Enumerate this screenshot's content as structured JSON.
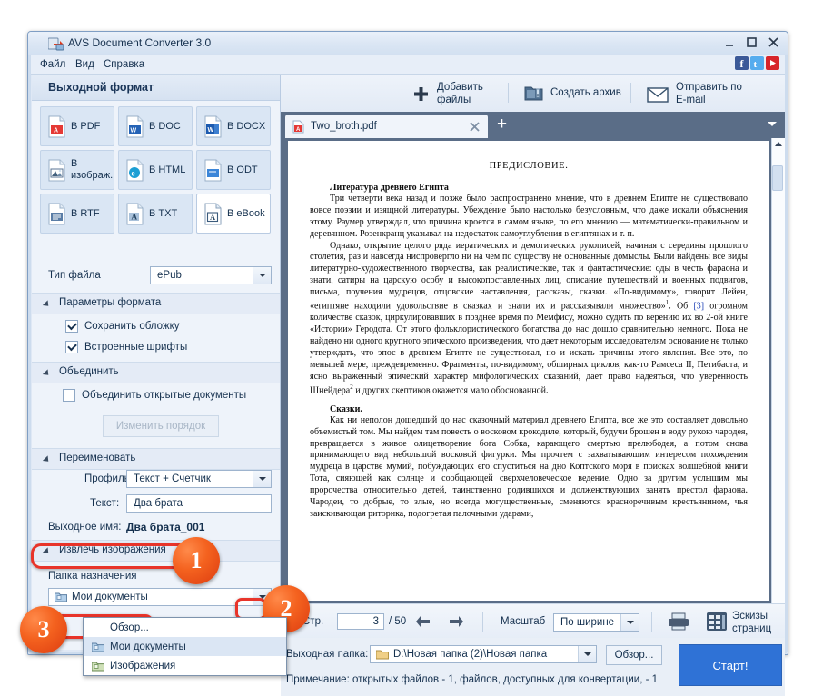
{
  "window": {
    "title": "AVS Document Converter 3.0",
    "icon": "avs-app-icon",
    "controls": {
      "minimize": "minimize-icon",
      "maximize": "maximize-icon",
      "close": "close-icon"
    }
  },
  "menu": {
    "items": [
      "Файл",
      "Вид",
      "Справка"
    ]
  },
  "social": [
    {
      "name": "facebook-icon",
      "glyph": "f",
      "color": "#3b5998"
    },
    {
      "name": "twitter-icon",
      "glyph": "t",
      "color": "#55acee"
    },
    {
      "name": "youtube-icon",
      "glyph": "▶",
      "color": "#d7242a"
    }
  ],
  "left_panel": {
    "header": "Выходной формат",
    "formats": [
      {
        "label": "В PDF",
        "icon": "pdf-file-icon",
        "selected": false
      },
      {
        "label": "В DOC",
        "icon": "doc-file-icon",
        "selected": false
      },
      {
        "label": "В DOCX",
        "icon": "docx-file-icon",
        "selected": false
      },
      {
        "label": "В изображ.",
        "icon": "image-file-icon",
        "selected": false
      },
      {
        "label": "В HTML",
        "icon": "html-file-icon",
        "selected": false
      },
      {
        "label": "В ODT",
        "icon": "odt-file-icon",
        "selected": false
      },
      {
        "label": "В RTF",
        "icon": "rtf-file-icon",
        "selected": false
      },
      {
        "label": "В TXT",
        "icon": "txt-file-icon",
        "selected": false
      },
      {
        "label": "В eBook",
        "icon": "ebook-file-icon",
        "selected": true
      }
    ],
    "filetype": {
      "label": "Тип файла",
      "value": "ePub"
    },
    "sections": {
      "format_params": "Параметры формата",
      "merge": "Объединить",
      "rename": "Переименовать",
      "extract_images": "Извлечь изображения"
    },
    "checkboxes": [
      {
        "label": "Сохранить обложку",
        "checked": true
      },
      {
        "label": "Встроенные шрифты",
        "checked": true
      },
      {
        "label": "Объединить открытые документы",
        "checked": false
      }
    ],
    "change_order_button": "Изменить порядок",
    "rename_fields": {
      "profile_label": "Профиль:",
      "profile_value": "Текст + Счетчик",
      "text_label": "Текст:",
      "text_value": "Два брата",
      "outname_label": "Выходное имя:",
      "outname_value": "Два брата_001"
    },
    "dest_folder": {
      "label": "Папка назначения",
      "value": "Мои документы",
      "icon": "folder-icon",
      "options": [
        {
          "label": "Обзор...",
          "icon": null,
          "highlighted": false
        },
        {
          "label": "Мои документы",
          "icon": "folder-icon",
          "highlighted": true
        },
        {
          "label": "Изображения",
          "icon": "folder-icon",
          "highlighted": false
        }
      ]
    }
  },
  "toolbar": {
    "add_files": {
      "label_line1": "Добавить",
      "label_line2": "файлы",
      "icon": "plus-icon"
    },
    "create_archive": {
      "label": "Создать архив",
      "icon": "archive-folder-icon"
    },
    "send_email": {
      "label_line1": "Отправить по",
      "label_line2": "E-mail",
      "icon": "envelope-icon"
    }
  },
  "tab": {
    "name": "Two_broth.pdf",
    "icon": "pdf-file-icon",
    "close": "close-icon",
    "add": "add-tab-icon",
    "caret": "chevron-down-icon"
  },
  "document": {
    "title": "ПРЕДИСЛОВИЕ.",
    "heading1": "Литература древнего Египта",
    "p1": "Три четверти века назад и позже было распространено мнение, что в древнем Египте не существовало вовсе поэзии и изящной литературы. Убеждение было настолько безусловным, что даже искали объяснения этому. Раумер утверждал, что причина кроется в самом языке, по его мнению — математически-правильном и деревянном. Розенкранц указывал на недостаток самоуглубления в египтянах и т. п.",
    "p2_a": "Однако, открытие целого ряда иератических и демотических рукописей, начиная с середины прошлого столетия, раз и навсегда ниспровергло ни на чем по существу не основанные домыслы. Были найдены все виды литературно-художественного творчества, как реалистические, так и фантастические: оды в честь фараона и знати, сатиры на царскую особу и высокопоставленных лиц, описание путешествий и военных подвигов, письма, поучения мудрецов, отцовские наставления, рассказы, сказки. «По-видимому», говорит Лейен, «египтяне находили удовольствие в сказках и знали их и рассказывали множество»",
    "p2_sup": "1",
    "p2_b": ". Об ",
    "p2_link": "[3]",
    "p2_c": " огромном количестве сказок, циркулировавших в позднее время по Мемфису, можно судить по верению их во 2-ой книге «Истории» Геродота. От этого фольклористического богатства до нас дошло сравнительно немного. Пока не найдено ни одного крупного эпического произведения, что дает некоторым исследователям основание не только утверждать, что эпос в древнем Египте не существовал, но и искать причины этого явления. Все это, по меньшей мере, преждевременно. Фрагменты, по-видимому, обширных циклов, как-то Рамсеса II, Петибаста, и ясно выраженный эпический характер мифологических сказаний, дает право надеяться, что уверенность Шнейдера",
    "p2_sup2": "2",
    "p2_d": " и других скептиков окажется мало обоснованной.",
    "heading2": "Сказки.",
    "p3": "Как ни неполон дошедший до нас сказочный материал древнего Египта, все же это составляет довольно объемистый том. Мы найдем там повесть о восковом крокодиле, который, будучи брошен в воду рукою чародея, превращается в живое олицетворение бога Собка, карающего смертью прелюбодея, а потом снова принимающего вид небольшой восковой фигурки. Мы прочтем с захватывающим интересом похождения мудреца в царстве мумий, побуждающих его спуститься на дно Коптского моря в поисках волшебной книги Тота, сияющей как солнце и сообщающей сверхчеловеческое ведение. Одно за другим услышим мы пророчества относительно детей, таинственно родившихся и долженствующих занять престол фараона. Чародеи, то добрые, то злые, но всегда могущественные, сменяются красноречивым крестьянином, чья заискивающая риторика, подогретая палочными ударами, "
  },
  "navbar": {
    "page_label": "Стр.",
    "page_value": "3",
    "page_total": "/ 50",
    "prev_icon": "arrow-left-icon",
    "next_icon": "arrow-right-icon",
    "zoom_label": "Масштаб",
    "zoom_value": "По ширине",
    "print_icon": "printer-icon",
    "thumbs_icon": "page-thumbnails-icon",
    "thumbs_label_1": "Эскизы",
    "thumbs_label_2": "страниц"
  },
  "bottom": {
    "outfolder_label": "Выходная папка:",
    "outfolder_value": "D:\\Новая папка (2)\\Новая папка",
    "outfolder_icon": "folder-icon",
    "browse_button": "Обзор...",
    "note": "Примечание: открытых файлов - 1, файлов, доступных для конвертации, - 1",
    "start_button": "Старт!"
  },
  "annotations": [
    {
      "number": "1"
    },
    {
      "number": "2"
    },
    {
      "number": "3"
    }
  ],
  "colors": {
    "accent": "#2f72d6",
    "annotation": "#e8342a",
    "bubble": "#f4621f"
  }
}
